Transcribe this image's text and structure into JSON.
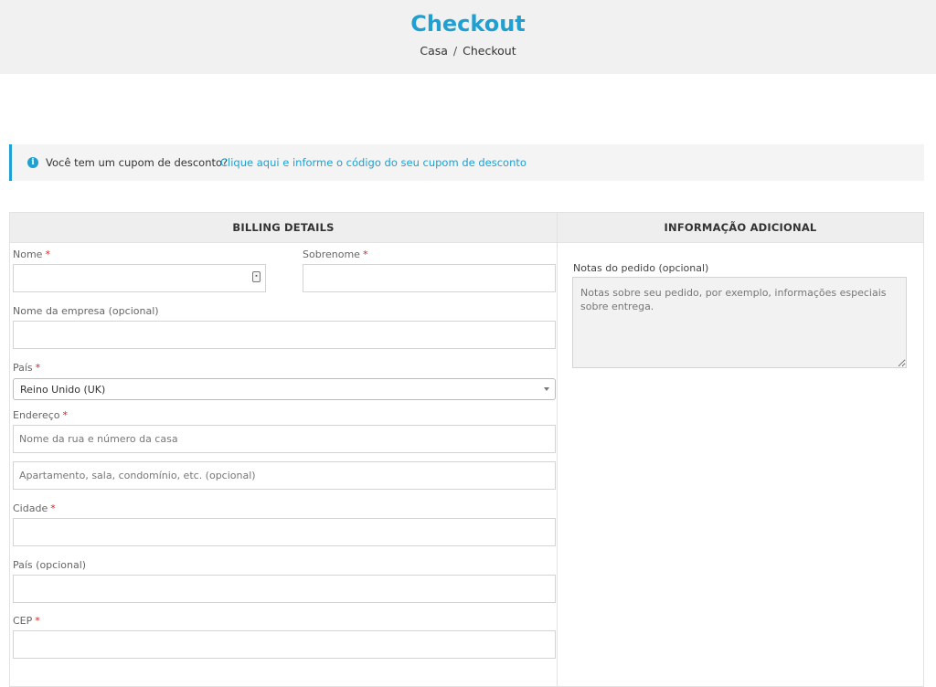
{
  "header": {
    "title": "Checkout",
    "breadcrumb": {
      "home": "Casa",
      "separator": "/",
      "current": "Checkout"
    }
  },
  "coupon": {
    "info_icon": "info-icon",
    "question": "Você tem um cupom de desconto?",
    "link": "Clique aqui e informe o código do seu cupom de desconto"
  },
  "billing": {
    "heading": "BILLING DETAILS",
    "required_mark": "*",
    "first_name": {
      "label": "Nome",
      "value": "",
      "contact_icon": "contact-card-icon"
    },
    "last_name": {
      "label": "Sobrenome",
      "value": ""
    },
    "company": {
      "label": "Nome da empresa (opcional)",
      "value": ""
    },
    "country": {
      "label": "País",
      "selected": "Reino Unido (UK)"
    },
    "address": {
      "label": "Endereço",
      "line1_placeholder": "Nome da rua e número da casa",
      "line2_placeholder": "Apartamento, sala, condomínio, etc. (opcional)"
    },
    "city": {
      "label": "Cidade",
      "value": ""
    },
    "county": {
      "label": "País (opcional)",
      "value": ""
    },
    "postcode": {
      "label": "CEP",
      "value": ""
    }
  },
  "additional": {
    "heading": "INFORMAÇÃO ADICIONAL",
    "notes_label": "Notas do pedido (opcional)",
    "notes_placeholder": "Notas sobre seu pedido, por exemplo, informações especiais sobre entrega."
  },
  "colors": {
    "accent": "#1fa0d0",
    "required": "#e02020",
    "header_bg": "#f1f1f1"
  }
}
